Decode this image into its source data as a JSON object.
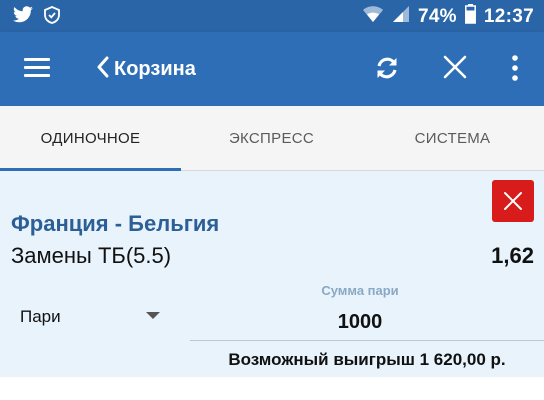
{
  "status_bar": {
    "left_icons": [
      "twitter-icon",
      "shield-icon"
    ],
    "battery": "74%",
    "time": "12:37",
    "right_icons": [
      "wifi-icon",
      "signal-icon",
      "battery-icon"
    ]
  },
  "app_bar": {
    "title": "Корзина",
    "icons": [
      "menu-icon",
      "back-chevron-icon",
      "refresh-icon",
      "close-icon",
      "more-vert-icon"
    ]
  },
  "tabs": [
    {
      "label": "ОДИНОЧНОЕ",
      "active": true
    },
    {
      "label": "ЭКСПРЕСС",
      "active": false
    },
    {
      "label": "СИСТЕМА",
      "active": false
    }
  ],
  "bet": {
    "match": "Франция - Бельгия",
    "market": "Замены ТБ(5.5)",
    "odds": "1,62",
    "bet_type": "Пари",
    "stake_label": "Сумма пари",
    "stake_value": "1000",
    "payout": "Возможный выигрыш 1 620,00 р."
  },
  "colors": {
    "status_bar": "#2a65a8",
    "app_bar": "#2d6eb7",
    "card_bg": "#e8f3fb",
    "remove_button": "#d81c1c",
    "match_text": "#2c5f95"
  }
}
